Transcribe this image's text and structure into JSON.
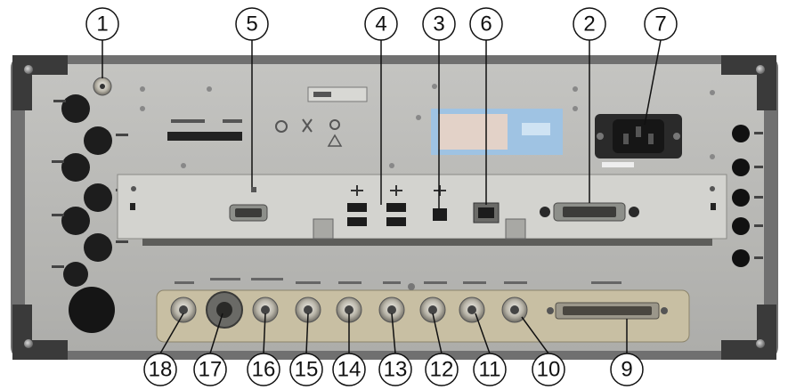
{
  "callouts": {
    "top": [
      "1",
      "5",
      "4",
      "3",
      "6",
      "2",
      "7"
    ],
    "bottom": [
      "18",
      "17",
      "16",
      "15",
      "14",
      "13",
      "12",
      "11",
      "10",
      "9"
    ]
  },
  "colors": {
    "panel": "#b9b9b6",
    "frame": "#6e6e6e",
    "bumper": "#3a3a3a",
    "lower_plate": "#c8bfa3",
    "label_blue": "#9fc3e3"
  }
}
